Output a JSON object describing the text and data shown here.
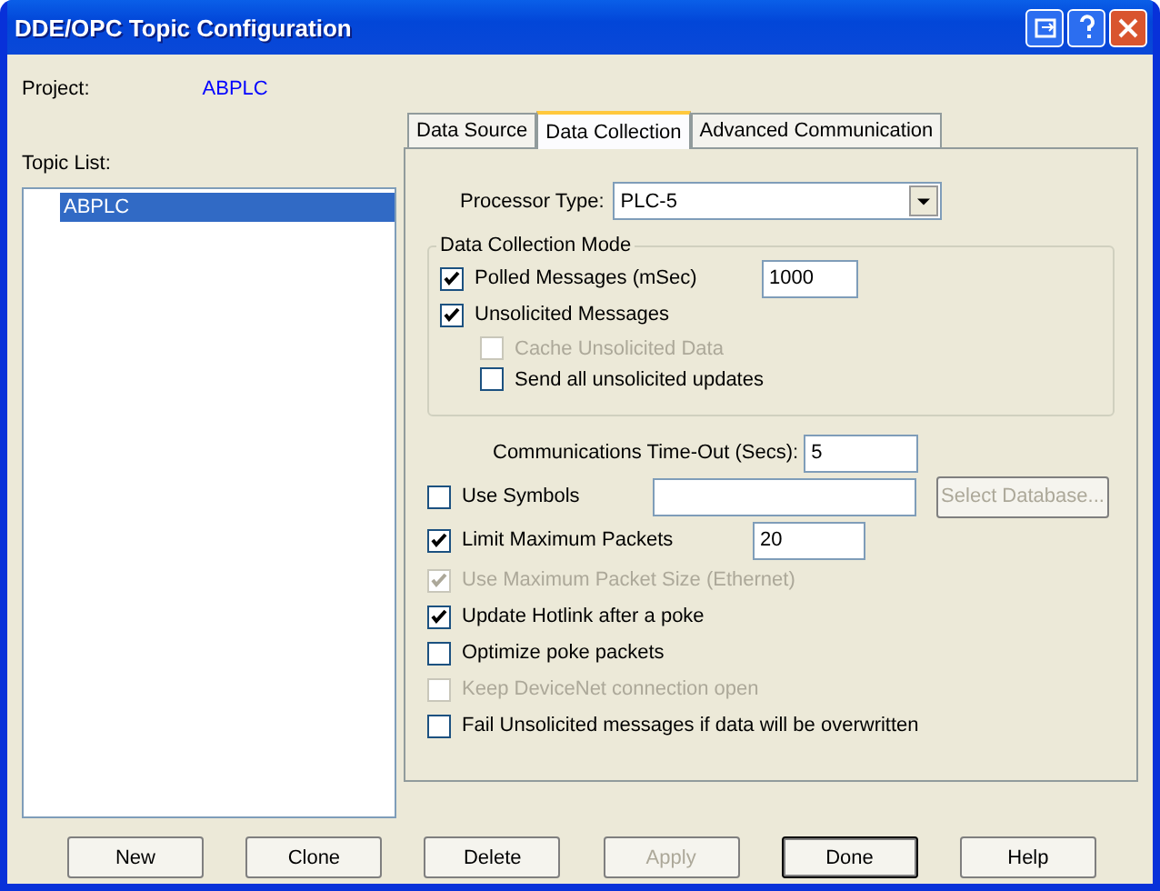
{
  "window": {
    "title": "DDE/OPC Topic Configuration"
  },
  "project": {
    "label": "Project:",
    "value": "ABPLC"
  },
  "topic_list": {
    "label": "Topic List:",
    "items": [
      {
        "label": "ABPLC",
        "selected": true
      }
    ]
  },
  "tabs": [
    {
      "label": "Data Source",
      "selected": false
    },
    {
      "label": "Data Collection",
      "selected": true
    },
    {
      "label": "Advanced Communication",
      "selected": false
    }
  ],
  "processor_type": {
    "label": "Processor Type:",
    "value": "PLC-5"
  },
  "data_collection_mode": {
    "title": "Data Collection Mode",
    "options": [
      {
        "label": "Polled Messages (mSec)",
        "checked": true,
        "disabled": false,
        "value": "1000"
      },
      {
        "label": "Unsolicited Messages",
        "checked": true,
        "disabled": false,
        "children": [
          {
            "label": "Cache Unsolicited Data",
            "checked": false,
            "disabled": true
          },
          {
            "label": "Send all unsolicited updates",
            "checked": false,
            "disabled": false
          }
        ]
      }
    ]
  },
  "timeout": {
    "label": "Communications Time-Out (Secs):",
    "value": "5"
  },
  "options": [
    {
      "kind": "field",
      "label": "Use Symbols",
      "checked": false,
      "disabled": false,
      "button": {
        "label": "Select Database...",
        "disabled": true
      }
    },
    {
      "kind": "field",
      "label": "Limit Maximum Packets",
      "checked": true,
      "disabled": false,
      "value": "20"
    },
    {
      "kind": "check",
      "label": "Use Maximum Packet Size (Ethernet)",
      "checked": true,
      "disabled": true
    },
    {
      "kind": "check",
      "label": "Update Hotlink after a poke",
      "checked": true,
      "disabled": false
    },
    {
      "kind": "check",
      "label": "Optimize poke packets",
      "checked": false,
      "disabled": false
    },
    {
      "kind": "check",
      "label": "Keep DeviceNet connection open",
      "checked": false,
      "disabled": true
    },
    {
      "kind": "check",
      "label": "Fail Unsolicited messages if data will be overwritten",
      "checked": false,
      "disabled": false
    }
  ],
  "buttons": [
    {
      "label": "New",
      "disabled": false,
      "default": false
    },
    {
      "label": "Clone",
      "disabled": false,
      "default": false
    },
    {
      "label": "Delete",
      "disabled": false,
      "default": false
    },
    {
      "label": "Apply",
      "disabled": true,
      "default": false
    },
    {
      "label": "Done",
      "disabled": false,
      "default": true
    },
    {
      "label": "Help",
      "disabled": false,
      "default": false
    }
  ]
}
